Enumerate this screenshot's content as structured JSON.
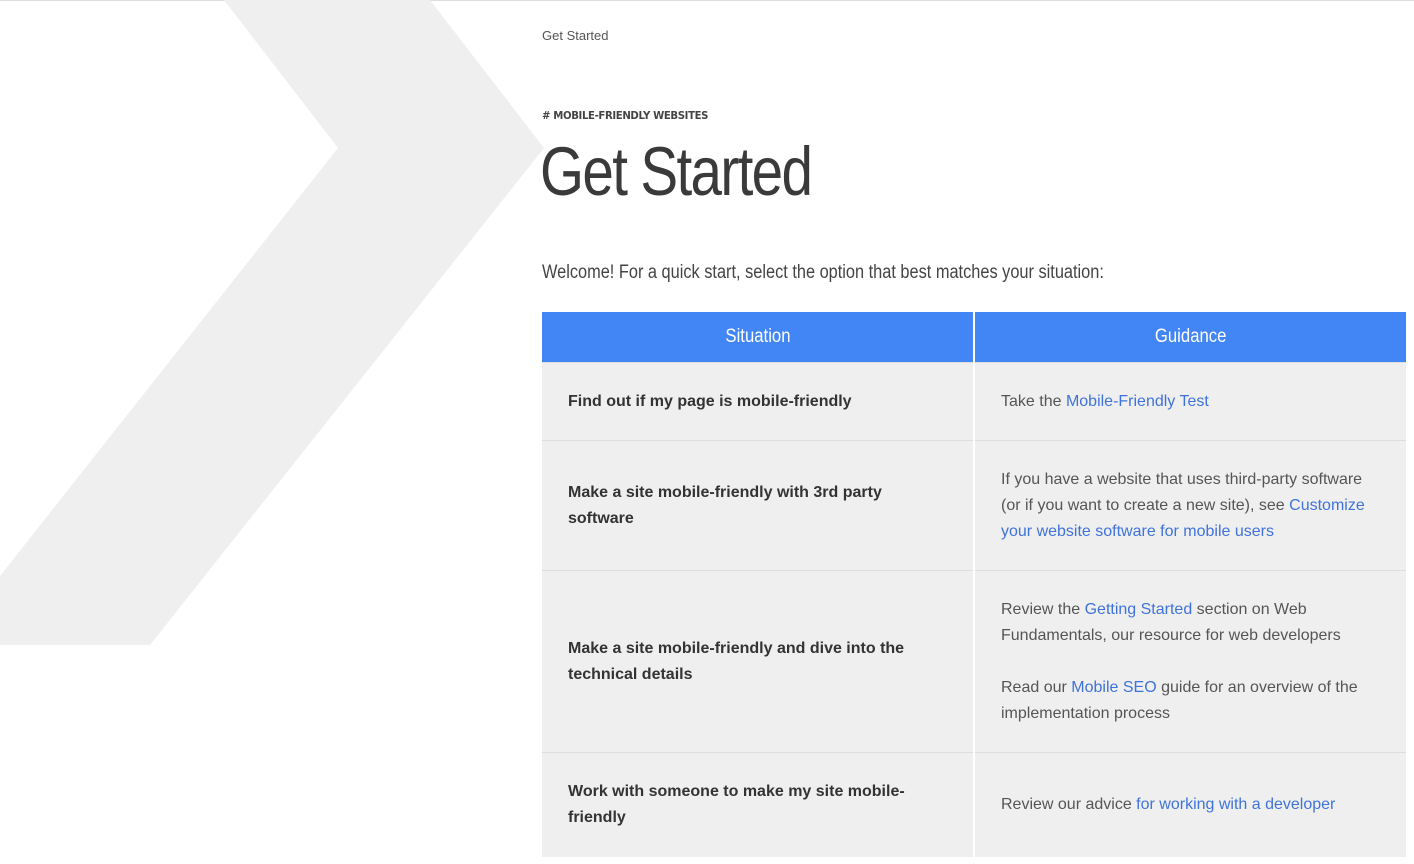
{
  "breadcrumb": "Get Started",
  "eyebrow": "# MOBILE-FRIENDLY WEBSITES",
  "title": "Get Started",
  "intro": "Welcome! For a quick start, select the option that best matches your situation:",
  "table": {
    "headers": [
      "Situation",
      "Guidance"
    ],
    "rows": [
      {
        "situation": "Find out if my page is mobile-friendly",
        "g": {
          "pre": "Take the ",
          "link": "Mobile-Friendly Test"
        }
      },
      {
        "situation": "Make a site mobile-friendly with 3rd party software",
        "g": {
          "pre": "If you have a website that uses third-party software (or if you want to create a new site), see ",
          "link": "Customize your website software for mobile users"
        }
      },
      {
        "situation": "Make a site mobile-friendly and dive into the technical details",
        "g": {
          "p1_pre": "Review the ",
          "p1_link": "Getting Started",
          "p1_post": " section on Web Fundamentals, our resource for web developers",
          "p2_pre": "Read our ",
          "p2_link": "Mobile SEO",
          "p2_post": " guide for an overview of the implementation process"
        }
      },
      {
        "situation": "Work with someone to make my site mobile-friendly",
        "g": {
          "pre": "Review our advice ",
          "link": "for working with a developer"
        }
      }
    ]
  },
  "colors": {
    "header_blue": "#4285f4",
    "link_blue": "#3f73da",
    "cell_gray": "#efefef",
    "chevron_gray": "#efefef"
  }
}
